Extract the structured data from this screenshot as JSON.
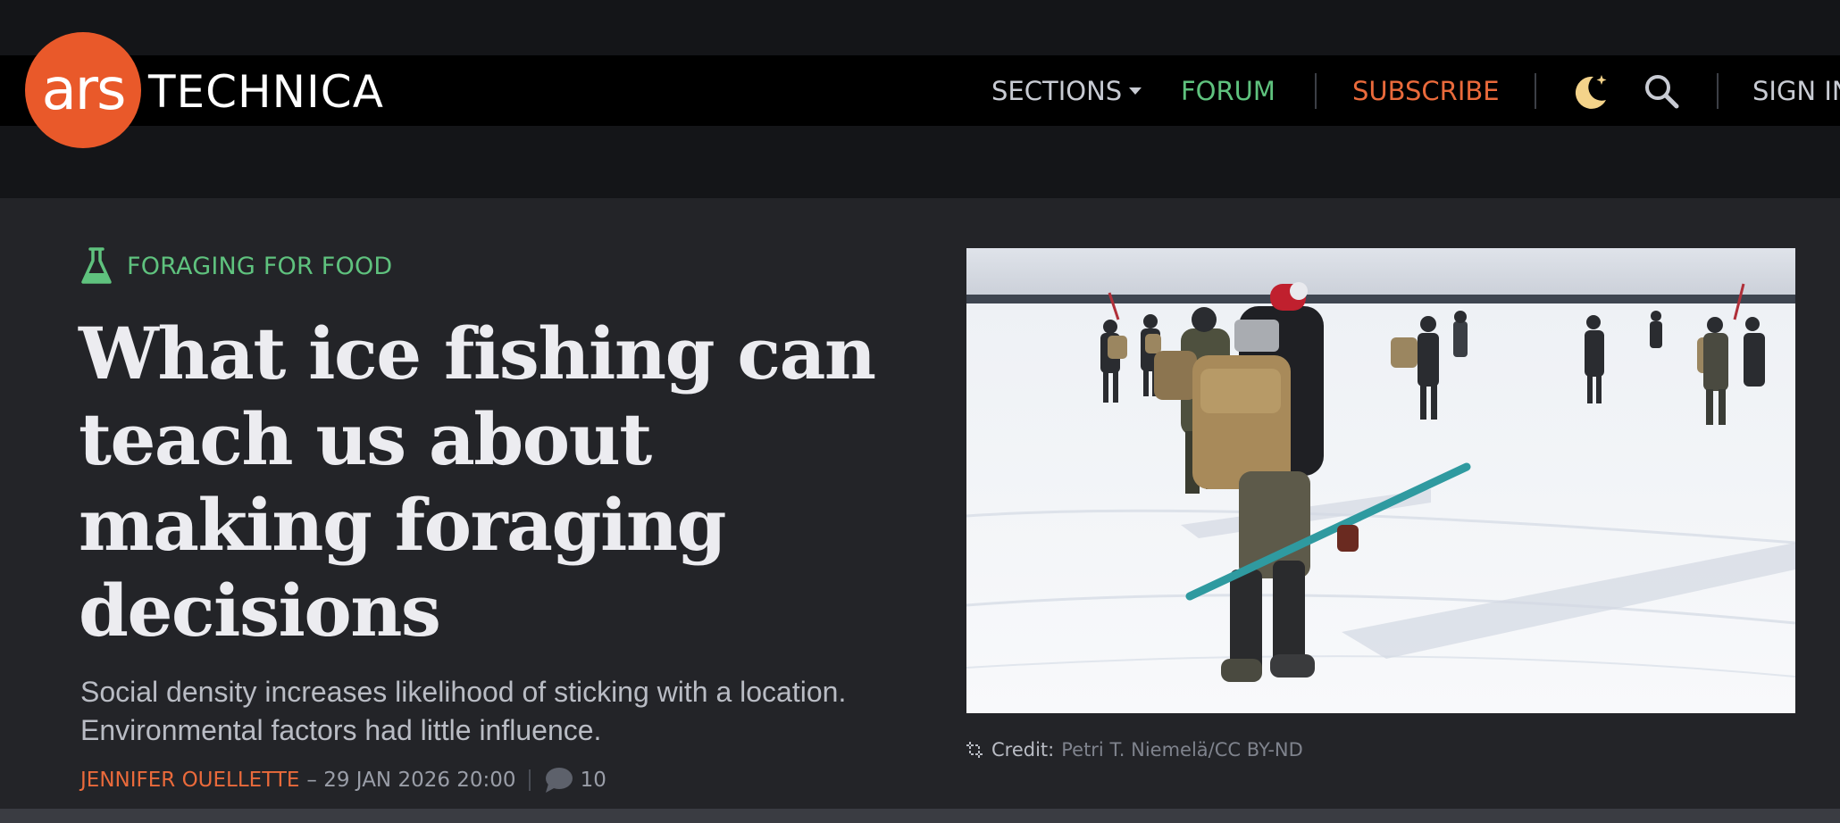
{
  "site": {
    "logo_mark": "ars",
    "logo_name": "TECHNICA"
  },
  "nav": {
    "sections_label": "SECTIONS",
    "forum_label": "FORUM",
    "subscribe_label": "SUBSCRIBE",
    "signin_label": "SIGN IN",
    "icons": [
      "moon-icon",
      "search-icon"
    ]
  },
  "article": {
    "kicker": "FORAGING FOR FOOD",
    "kicker_icon": "flask-icon",
    "headline": "What ice fishing can teach us about making foraging decisions",
    "dek": "Social density increases likelihood of sticking with a location. Environmental factors had little influence.",
    "author": "JENNIFER OUELLETTE",
    "date": "– 29 JAN 2026 20:00",
    "comment_count": "10",
    "image_credit_label": "Credit:",
    "image_credit": "Petri T. Niemelä/CC BY-ND"
  },
  "colors": {
    "brand_orange": "#e9592a",
    "forum_green": "#5fc27e",
    "accent_orange": "#ea6a3b",
    "background": "#232428",
    "navbar": "#000000"
  }
}
